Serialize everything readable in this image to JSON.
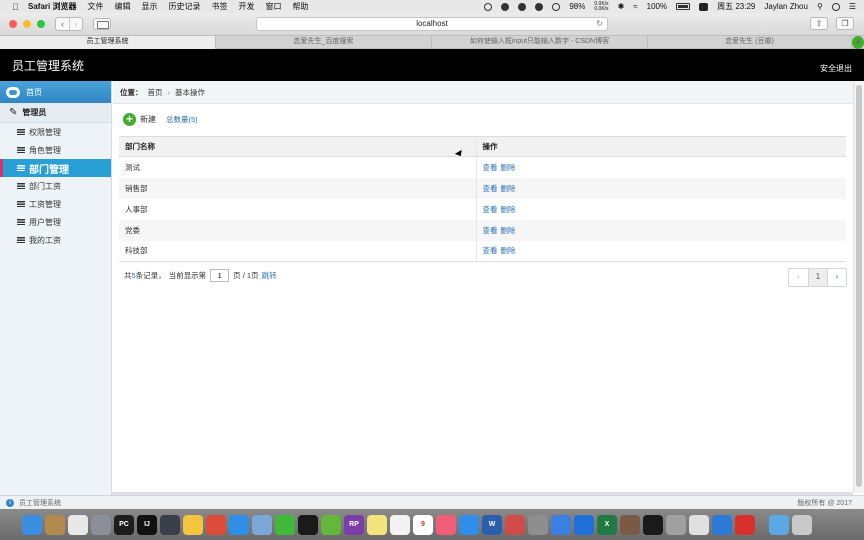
{
  "menubar": {
    "apple": "",
    "app": "Safari 浏览器",
    "items": [
      "文件",
      "编辑",
      "显示",
      "历史记录",
      "书签",
      "开发",
      "窗口",
      "帮助"
    ],
    "battery": "98%",
    "net_up": "0.0K/s",
    "net_down": "0.0K/s",
    "volume": "100%",
    "datetime": "周五 23:29",
    "user": "Jaylan Zhou"
  },
  "browser": {
    "url": "localhost",
    "tabs": [
      {
        "label": "员工管理系统",
        "active": true
      },
      {
        "label": "恋爱先生_百度搜索",
        "active": false
      },
      {
        "label": "如何使输入框input只能输入数字 - CSDN博客",
        "active": false
      },
      {
        "label": "恋爱先生 (豆瓣)",
        "active": false
      }
    ],
    "new_tab": "+"
  },
  "app": {
    "title": "员工管理系统",
    "logout": "安全退出"
  },
  "sidebar": {
    "home": "首页",
    "group": "管理员",
    "items": [
      {
        "label": "权限管理"
      },
      {
        "label": "角色管理"
      },
      {
        "label": "部门管理",
        "active": true
      },
      {
        "label": "部门工资"
      },
      {
        "label": "工资管理"
      },
      {
        "label": "用户管理"
      },
      {
        "label": "我的工资"
      }
    ]
  },
  "breadcrumb": {
    "prefix": "位置：",
    "home": "首页",
    "separator": "›",
    "current": "基本操作"
  },
  "actions": {
    "new_label": "新建",
    "total_label": "总数量(5)"
  },
  "table": {
    "headers": [
      "部门名称",
      "操作"
    ],
    "rows": [
      {
        "name": "测试",
        "view": "查看",
        "delete": "删除"
      },
      {
        "name": "销售部",
        "view": "查看",
        "delete": "删除"
      },
      {
        "name": "人事部",
        "view": "查看",
        "delete": "删除"
      },
      {
        "name": "党委",
        "view": "查看",
        "delete": "删除"
      },
      {
        "name": "科技部",
        "view": "查看",
        "delete": "删除"
      }
    ]
  },
  "pager": {
    "total_prefix": "共",
    "total_count": "5",
    "total_suffix": "条记录，",
    "current_prefix": "当前显示第",
    "current_page": "1",
    "page_suffix": "页 / 1页",
    "jump": "跳转",
    "prev": "‹",
    "page_button": "1",
    "next": "›"
  },
  "footer": {
    "info_icon": "i",
    "app_name": "员工管理系统",
    "copyright": "版权所有 @ 2017"
  },
  "dock": {
    "items": [
      {
        "icon": "finder-icon",
        "color": "#3b8fe0",
        "label": ""
      },
      {
        "icon": "notes-book-icon",
        "color": "#b08a4e",
        "label": ""
      },
      {
        "icon": "photos-icon",
        "color": "#e8e8e8",
        "label": ""
      },
      {
        "icon": "launchpad-rocket-icon",
        "color": "#8a8f99",
        "label": ""
      },
      {
        "icon": "pycharm-icon",
        "color": "#1d1d1d",
        "label": "PC"
      },
      {
        "icon": "intellij-icon",
        "color": "#111111",
        "label": "IJ"
      },
      {
        "icon": "sublime-icon",
        "color": "#3a3f4b",
        "label": ""
      },
      {
        "icon": "potato-icon",
        "color": "#f3c43c",
        "label": ""
      },
      {
        "icon": "chrome-icon",
        "color": "#de4b3a",
        "label": ""
      },
      {
        "icon": "safari-icon",
        "color": "#2e8ee8",
        "label": ""
      },
      {
        "icon": "preview-icon",
        "color": "#7aa7d8",
        "label": ""
      },
      {
        "icon": "wechat-icon",
        "color": "#3fba38",
        "label": ""
      },
      {
        "icon": "qq-icon",
        "color": "#1a1a1a",
        "label": ""
      },
      {
        "icon": "ball-icon",
        "color": "#63b83a",
        "label": ""
      },
      {
        "icon": "axure-rp-icon",
        "color": "#7a3ea6",
        "label": "RP"
      },
      {
        "icon": "stickies-icon",
        "color": "#f4e27a",
        "label": ""
      },
      {
        "icon": "notes-icon",
        "color": "#f2f2f2",
        "label": ""
      },
      {
        "icon": "calendar-icon",
        "color": "#ffffff",
        "label": "9"
      },
      {
        "icon": "music-icon",
        "color": "#f25d78",
        "label": ""
      },
      {
        "icon": "appstore-icon",
        "color": "#2f8ee9",
        "label": ""
      },
      {
        "icon": "word-icon",
        "color": "#2b5fae",
        "label": "W"
      },
      {
        "icon": "magnet-icon",
        "color": "#d24b4b",
        "label": ""
      },
      {
        "icon": "system-preferences-icon",
        "color": "#8e8e8e",
        "label": ""
      },
      {
        "icon": "baidu-netdisk-icon",
        "color": "#3b7fe0",
        "label": ""
      },
      {
        "icon": "teamviewer-icon",
        "color": "#1e6fd9",
        "label": ""
      },
      {
        "icon": "excel-icon",
        "color": "#1f7a44",
        "label": "X"
      },
      {
        "icon": "slides-icon",
        "color": "#7a5a44",
        "label": ""
      },
      {
        "icon": "qq-icon",
        "color": "#1a1a1a",
        "label": ""
      },
      {
        "icon": "script-icon",
        "color": "#a0a0a0",
        "label": ""
      },
      {
        "icon": "java-icon",
        "color": "#e0e0e0",
        "label": ""
      },
      {
        "icon": "edge-icon",
        "color": "#2c7ad6",
        "label": ""
      },
      {
        "icon": "netease-music-icon",
        "color": "#d8312d",
        "label": ""
      },
      {
        "icon": "folder-icon",
        "color": "#5aa9e6",
        "label": ""
      },
      {
        "icon": "trash-icon",
        "color": "#c9c9c9",
        "label": ""
      }
    ]
  }
}
